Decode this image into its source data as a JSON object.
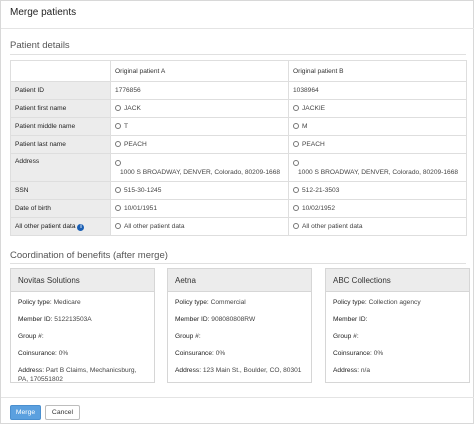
{
  "dialog": {
    "title": "Merge patients"
  },
  "patient_details": {
    "section_title": "Patient details",
    "columns": [
      "",
      "Original patient A",
      "Original patient B"
    ],
    "rows": [
      {
        "label": "Patient ID",
        "a": "1776856",
        "b": "1038964"
      },
      {
        "label": "Patient first name",
        "a": "JACK",
        "b": "JACKIE"
      },
      {
        "label": "Patient middle name",
        "a": "T",
        "b": "M"
      },
      {
        "label": "Patient last name",
        "a": "PEACH",
        "b": "PEACH"
      },
      {
        "label": "Address",
        "a": "1000 S BROADWAY, DENVER, Colorado, 80209-1668",
        "b": "1000 S BROADWAY, DENVER, Colorado, 80209-1668"
      },
      {
        "label": "SSN",
        "a": "515-30-1245",
        "b": "512-21-3503"
      },
      {
        "label": "Date of birth",
        "a": "10/01/1951",
        "b": "10/02/1952"
      },
      {
        "label": "All other patient data",
        "a": "All other patient data",
        "b": "All other patient data"
      }
    ],
    "info_icon_glyph": "i"
  },
  "cob": {
    "section_title": "Coordination of benefits (after merge)",
    "labels": {
      "policy_type": "Policy type:",
      "member_id": "Member ID:",
      "group": "Group #:",
      "coinsurance": "Coinsurance:",
      "address": "Address:"
    },
    "cards": [
      {
        "name": "Novitas Solutions",
        "policy_type": "Medicare",
        "member_id": "512213503A",
        "group": "",
        "coinsurance": "0%",
        "address": "Part B Claims, Mechanicsburg, PA, 170551802"
      },
      {
        "name": "Aetna",
        "policy_type": "Commercial",
        "member_id": "908080808RW",
        "group": "",
        "coinsurance": "0%",
        "address": "123 Main St., Boulder, CO, 80301"
      },
      {
        "name": "ABC Collections",
        "policy_type": "Collection agency",
        "member_id": "",
        "group": "",
        "coinsurance": "0%",
        "address": "n/a"
      }
    ]
  },
  "footer": {
    "merge_label": "Merge",
    "cancel_label": "Cancel"
  }
}
